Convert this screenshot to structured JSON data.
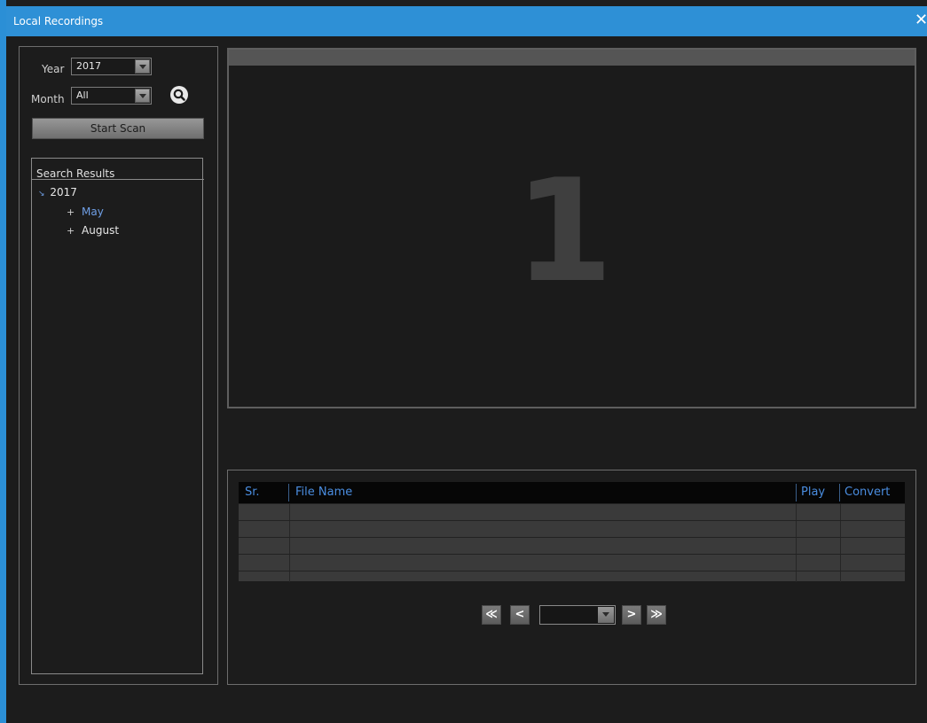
{
  "window": {
    "title": "Local Recordings",
    "close_glyph": "✕"
  },
  "filters": {
    "year_label": "Year",
    "year_value": "2017",
    "month_label": "Month",
    "month_value": "All",
    "search_icon": "search-icon",
    "scan_button": "Start Scan"
  },
  "results": {
    "title": "Search Results",
    "root_marker": "↘",
    "root": "2017",
    "children": [
      {
        "label": "May",
        "color": "#6f9fe6"
      },
      {
        "label": "August",
        "color": "#e8e8e8"
      }
    ],
    "expand_glyph": "+"
  },
  "viewer": {
    "channel_number": "1"
  },
  "table": {
    "columns": [
      "Sr.",
      "File Name",
      "Play",
      "Convert"
    ],
    "rows": [
      [
        "",
        "",
        "",
        ""
      ],
      [
        "",
        "",
        "",
        ""
      ],
      [
        "",
        "",
        "",
        ""
      ],
      [
        "",
        "",
        "",
        ""
      ],
      [
        "",
        "",
        "",
        ""
      ]
    ]
  },
  "pager": {
    "first": "≪",
    "prev": "<",
    "next": ">",
    "last": "≫",
    "page_value": ""
  }
}
